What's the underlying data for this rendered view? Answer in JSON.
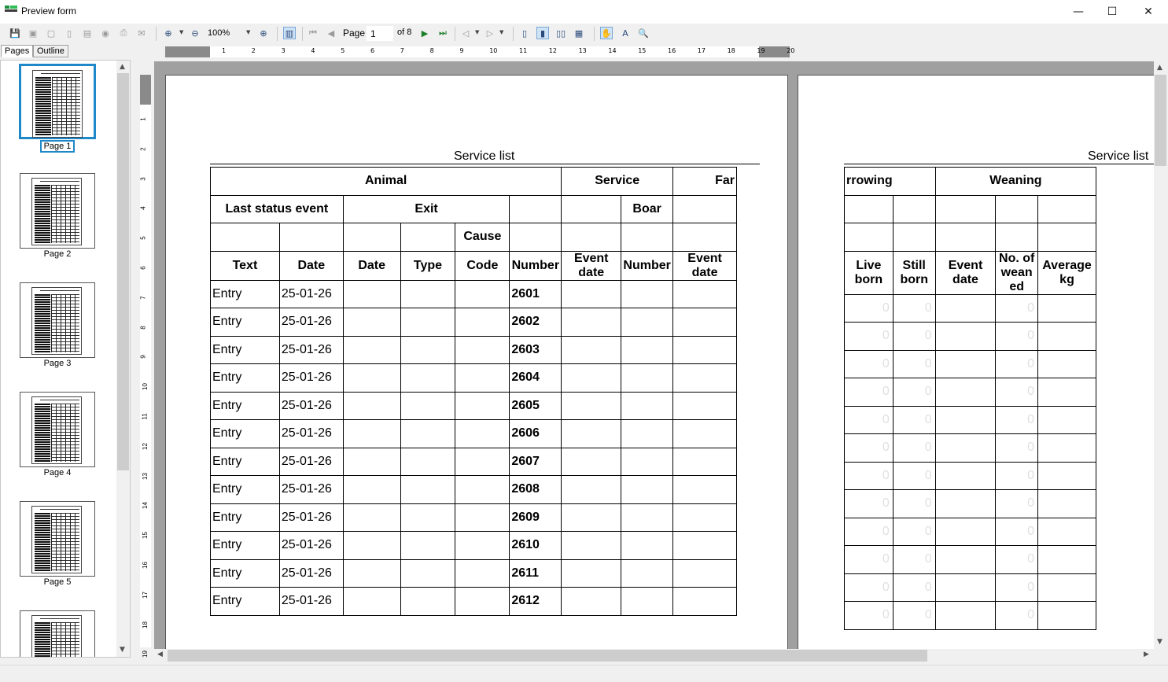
{
  "window": {
    "title": "Preview form",
    "minimize": "—",
    "maximize": "☐",
    "close": "✕"
  },
  "toolbar": {
    "zoom": "100%",
    "page_label": "Page",
    "page_value": "1",
    "of_label": "of 8"
  },
  "tabs": [
    "Pages",
    "Outline"
  ],
  "thumbnails": [
    "Page 1",
    "Page 2",
    "Page 3",
    "Page 4",
    "Page 5"
  ],
  "ruler": {
    "h": [
      "1",
      "2",
      "3",
      "4",
      "5",
      "6",
      "7",
      "8",
      "9",
      "10",
      "11",
      "12",
      "13",
      "14",
      "15",
      "16",
      "17",
      "18",
      "19",
      "20"
    ],
    "v": [
      "1",
      "2",
      "3",
      "4",
      "5",
      "6",
      "7",
      "8",
      "9",
      "10",
      "11",
      "12",
      "13",
      "14",
      "15",
      "16",
      "17",
      "18",
      "19"
    ]
  },
  "page1": {
    "title": "Service list",
    "g1": {
      "animal": "Animal",
      "service": "Service",
      "farrowing": "Far"
    },
    "g2": {
      "last_status": "Last status event",
      "exit": "Exit",
      "boar": "Boar"
    },
    "g3": {
      "cause": "Cause"
    },
    "cols": [
      "Text",
      "Date",
      "Date",
      "Type",
      "Code",
      "Number",
      "Event date",
      "Number",
      "Event date"
    ],
    "rows": [
      [
        "Entry",
        "25-01-26",
        "2601"
      ],
      [
        "Entry",
        "25-01-26",
        "2602"
      ],
      [
        "Entry",
        "25-01-26",
        "2603"
      ],
      [
        "Entry",
        "25-01-26",
        "2604"
      ],
      [
        "Entry",
        "25-01-26",
        "2605"
      ],
      [
        "Entry",
        "25-01-26",
        "2606"
      ],
      [
        "Entry",
        "25-01-26",
        "2607"
      ],
      [
        "Entry",
        "25-01-26",
        "2608"
      ],
      [
        "Entry",
        "25-01-26",
        "2609"
      ],
      [
        "Entry",
        "25-01-26",
        "2610"
      ],
      [
        "Entry",
        "25-01-26",
        "2611"
      ],
      [
        "Entry",
        "25-01-26",
        "2612"
      ]
    ]
  },
  "page2": {
    "title": "Service list",
    "g1": {
      "farrowing": "rrowing",
      "weaning": "Weaning"
    },
    "cols": [
      "Live born",
      "Still born",
      "Event date",
      "No. of weaned",
      "Average kg"
    ],
    "zero": "0"
  }
}
